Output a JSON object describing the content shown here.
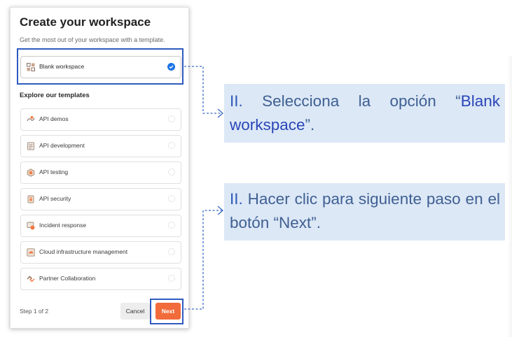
{
  "dialog": {
    "title": "Create your workspace",
    "subtitle": "Get the most out of your workspace with a template.",
    "blank_option": {
      "label": "Blank workspace",
      "selected": true
    },
    "templates_heading": "Explore our templates",
    "templates": [
      {
        "label": "API demos",
        "icon": "api-demos-icon"
      },
      {
        "label": "API development",
        "icon": "api-development-icon"
      },
      {
        "label": "API testing",
        "icon": "api-testing-icon"
      },
      {
        "label": "API security",
        "icon": "api-security-icon"
      },
      {
        "label": "Incident response",
        "icon": "incident-response-icon"
      },
      {
        "label": "Cloud infrastructure management",
        "icon": "cloud-infrastructure-icon"
      },
      {
        "label": "Partner Collaboration",
        "icon": "partner-collaboration-icon"
      }
    ],
    "footer": {
      "step": "Step 1 of 2",
      "cancel_label": "Cancel",
      "next_label": "Next"
    }
  },
  "callouts": [
    {
      "num": "II.",
      "text_a": " Selecciona la opción “",
      "highlight": "Blank workspace",
      "text_b": "”."
    },
    {
      "num": "II.",
      "text": " Hacer clic para siguiente paso en el botón “Next”."
    }
  ],
  "colors": {
    "accent_orange": "#f26b3a",
    "highlight_border": "#2f5bbf",
    "callout_bg": "#dce8f6",
    "callout_text": "#3f5f92",
    "check_blue": "#1a73e8"
  }
}
